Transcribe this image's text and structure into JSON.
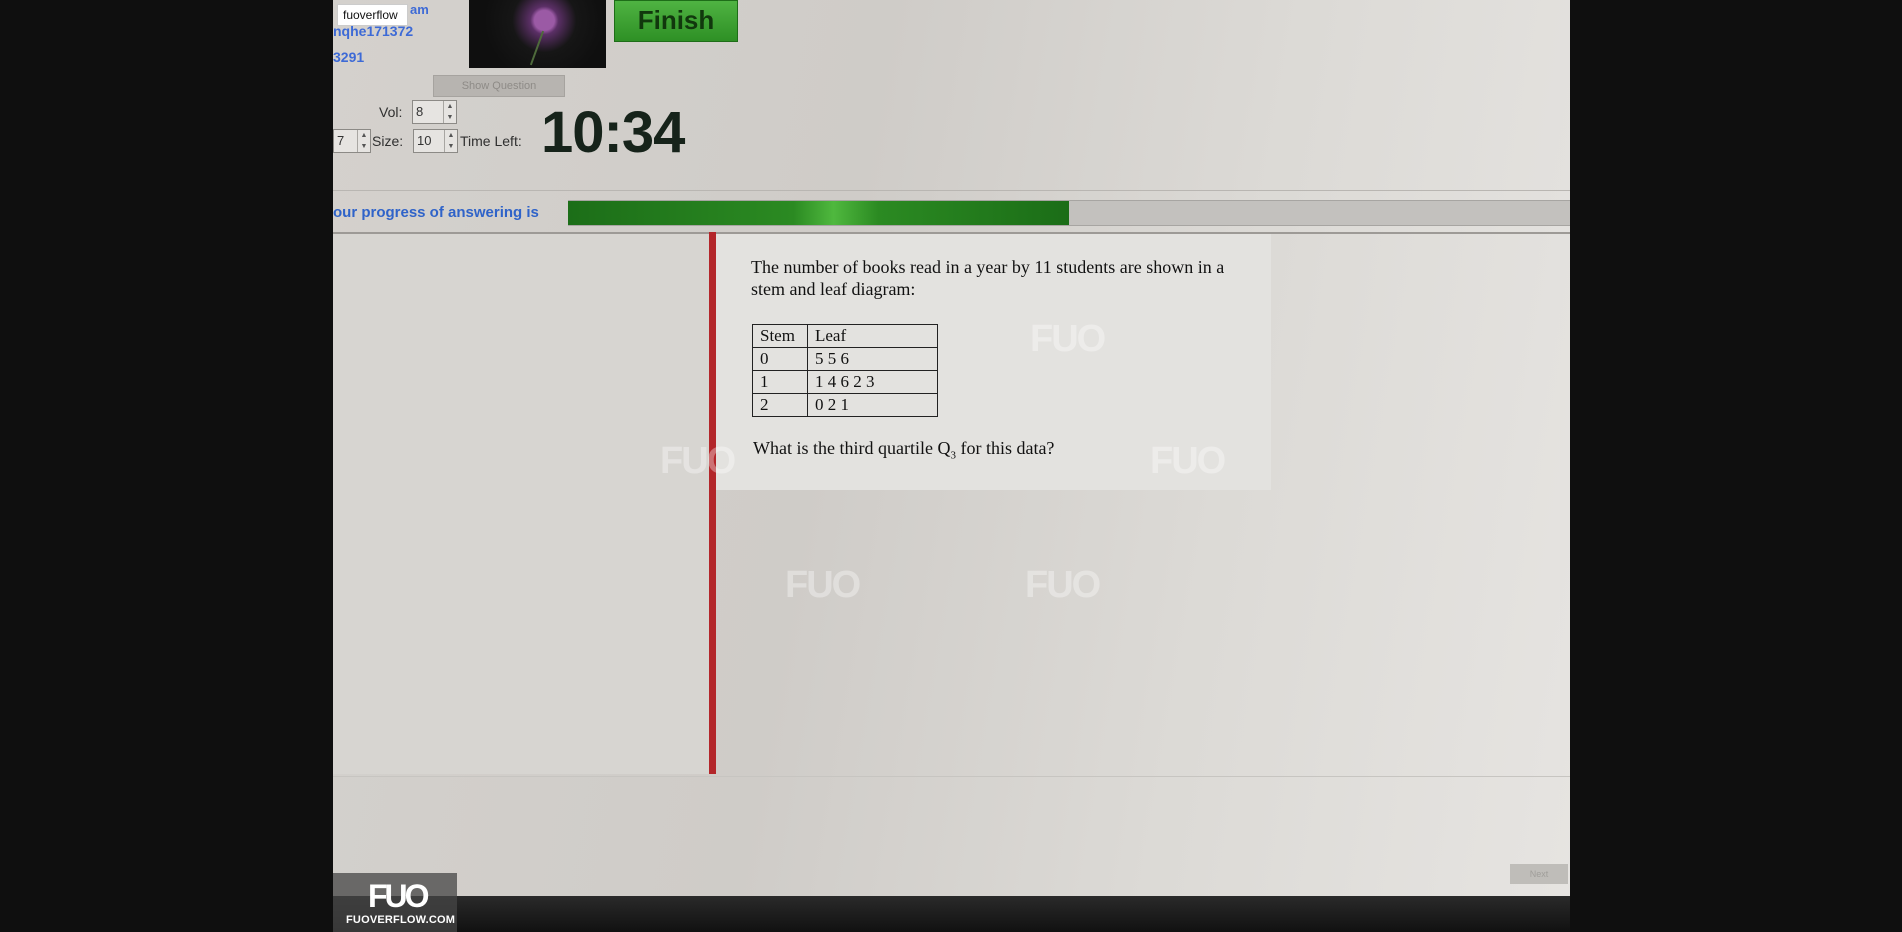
{
  "watermark_tag": "fuoverflow",
  "user": {
    "line1": "am",
    "line2": "nqhe171372",
    "line3": "3291"
  },
  "buttons": {
    "finish": "Finish",
    "show_question": "Show Question"
  },
  "controls": {
    "vol_label": "Vol:",
    "vol_value": "8",
    "left_value": "7",
    "size_label": "Size:",
    "size_value": "10",
    "time_left_label": "Time Left:",
    "timer": "10:34"
  },
  "progress": {
    "label": "our progress of answering is",
    "fraction": 0.5
  },
  "question": {
    "intro": "The number of books read in a year by 11 students are shown in a stem and leaf diagram:",
    "table": {
      "headers": [
        "Stem",
        "Leaf"
      ],
      "rows": [
        [
          "0",
          "5 5 6"
        ],
        [
          "1",
          "1 4 6 2 3"
        ],
        [
          "2",
          "0 2 1"
        ]
      ]
    },
    "prompt_before": "What is the third quartile Q",
    "prompt_sub": "3",
    "prompt_after": " for this data?"
  },
  "next_button": "Next",
  "logo": {
    "mark": "FUO",
    "site": "FUOVERFLOW.COM"
  },
  "colors": {
    "progress_green": "#2b8a22",
    "finish_green": "#3fa235",
    "divider_red": "#b3262a",
    "link_blue": "#2f63c9"
  }
}
